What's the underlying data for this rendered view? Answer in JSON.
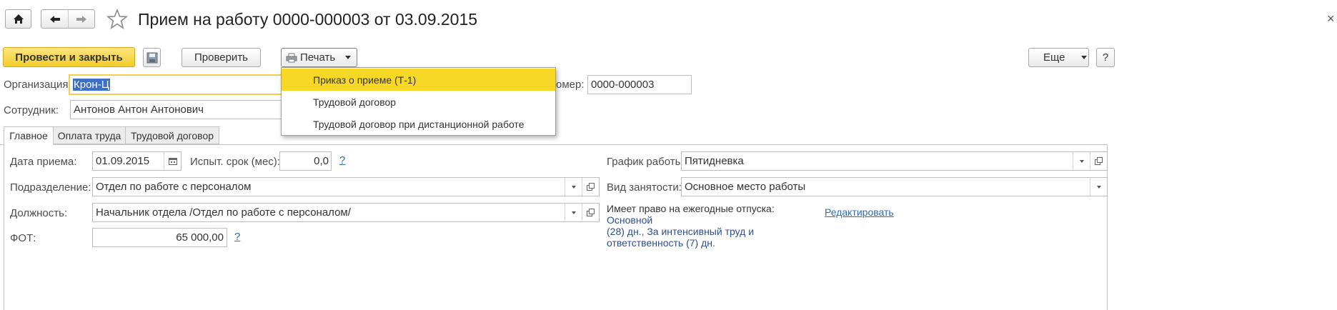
{
  "window": {
    "title": "Прием на работу 0000-000003 от 03.09.2015"
  },
  "toolbar": {
    "post_close": "Провести и закрыть",
    "check": "Проверить",
    "print": "Печать",
    "more": "Еще",
    "help": "?"
  },
  "print_menu": {
    "items": [
      "Приказ о приеме (Т-1)",
      "Трудовой договор",
      "Трудовой договор при дистанционной работе"
    ]
  },
  "header": {
    "org_label": "Организация:",
    "org_value": "Крон-Ц",
    "number_label": "Номер:",
    "number_visible_label": "омер:",
    "number_value": "0000-000003",
    "employee_label": "Сотрудник:",
    "employee_value": "Антонов Антон Антонович"
  },
  "tabs": [
    "Главное",
    "Оплата труда",
    "Трудовой договор"
  ],
  "main": {
    "hire_date_label": "Дата приема:",
    "hire_date_value": "01.09.2015",
    "probation_label": "Испыт. срок (мес):",
    "probation_value": "0,0",
    "help_mark": "?",
    "schedule_label": "График работы:",
    "schedule_value": "Пятидневка",
    "department_label": "Подразделение:",
    "department_value": "Отдел по работе с персоналом",
    "employment_label": "Вид занятости:",
    "employment_value": "Основное место работы",
    "position_label": "Должность:",
    "position_value": "Начальник отдела /Отдел по работе с персоналом/",
    "vacation_label": "Имеет право на ежегодные отпуска:",
    "vacation_value_1": "Основной",
    "vacation_value_2": "(28) дн., За интенсивный труд и",
    "vacation_value_3": "ответственность (7) дн.",
    "edit_link": "Редактировать",
    "fot_label": "ФОТ:",
    "fot_value": "65 000,00"
  },
  "colors": {
    "accent": "#f5d230",
    "menu_highlight": "#f7d826",
    "link": "#2b6cb5",
    "vacation_text": "#2f4e8f"
  }
}
